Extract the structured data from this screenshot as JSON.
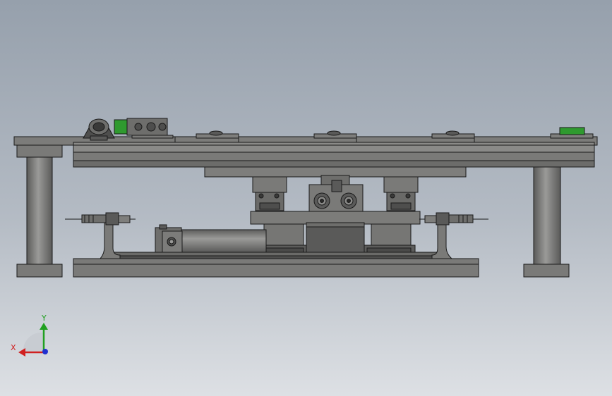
{
  "colors": {
    "background_top": "#9aa3ae",
    "background_bottom": "#d9dde2",
    "metal_light": "#8a8a88",
    "metal_mid": "#6e6e6c",
    "metal_dark": "#4e4e4d",
    "outline": "#1a1a1a",
    "accent_green": "#2f9a2f",
    "axis_x": "#d02020",
    "axis_y": "#20a020",
    "axis_z": "#2030d0"
  },
  "triad": {
    "x_label": "X",
    "y_label": "Y"
  }
}
